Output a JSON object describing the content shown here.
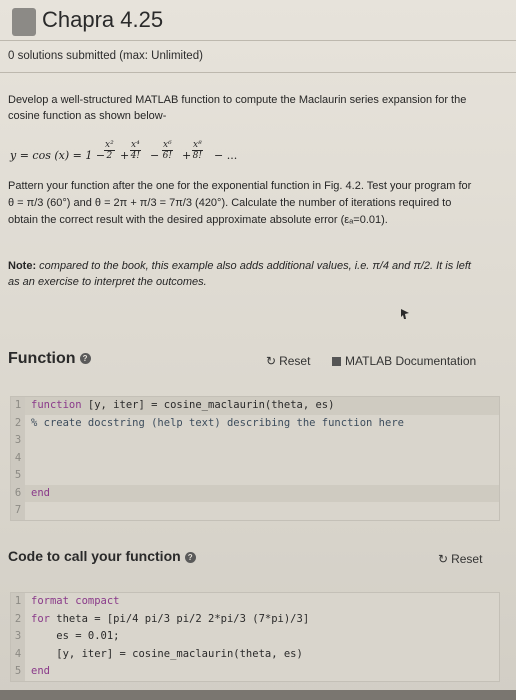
{
  "header": {
    "title": "Chapra 4.25",
    "submitted": "0 solutions submitted (max: Unlimited)"
  },
  "problem": {
    "intro": "Develop a well-structured MATLAB function to compute the Maclaurin series expansion for the cosine function as shown below-",
    "formula": {
      "lhs": "y = cos (x) = 1 −",
      "terms": [
        {
          "num": "x²",
          "den": "2",
          "op": "+"
        },
        {
          "num": "x⁴",
          "den": "4!",
          "op": "−"
        },
        {
          "num": "x⁶",
          "den": "6!",
          "op": "+"
        },
        {
          "num": "x⁸",
          "den": "8!",
          "op": "− ..."
        }
      ]
    },
    "pattern": "Pattern your function after the one for the exponential function in Fig. 4.2. Test your program for θ = π/3 (60°) and θ = 2π + π/3 = 7π/3 (420°). Calculate the number of iterations required to obtain the correct result with the desired approximate absolute error (εₐ=0.01).",
    "note_label": "Note:",
    "note_text": " compared to the book, this example also adds additional values, i.e. π/4 and π/2. It is left as an exercise to interpret the outcomes."
  },
  "function_section": {
    "title": "Function",
    "reset_label": "Reset",
    "doc_label": "MATLAB Documentation",
    "lines": [
      {
        "n": "1",
        "kw": "function",
        "text": " [y, iter] = cosine_maclaurin(theta, es)",
        "type": "kw"
      },
      {
        "n": "2",
        "text": "% create docstring (help text) describing the function here",
        "type": "comment"
      },
      {
        "n": "3",
        "text": "",
        "type": "plain"
      },
      {
        "n": "4",
        "text": "",
        "type": "plain"
      },
      {
        "n": "5",
        "text": "",
        "type": "plain"
      },
      {
        "n": "6",
        "kw": "end",
        "text": "",
        "type": "kw"
      },
      {
        "n": "7",
        "text": "",
        "type": "plain"
      }
    ]
  },
  "call_section": {
    "title": "Code to call your function",
    "reset_label": "Reset",
    "lines": [
      {
        "n": "1",
        "text": "format compact",
        "type": "kwline"
      },
      {
        "n": "2",
        "kw": "for",
        "text": " theta = [pi/4 pi/3 pi/2 2*pi/3 (7*pi)/3]",
        "type": "kw"
      },
      {
        "n": "3",
        "text": "    es = 0.01;",
        "type": "plain"
      },
      {
        "n": "4",
        "text": "    [y, iter] = cosine_maclaurin(theta, es)",
        "type": "plain"
      },
      {
        "n": "5",
        "kw": "end",
        "text": "",
        "type": "kw"
      }
    ]
  },
  "icons": {
    "reset": "refresh-icon",
    "help": "question-icon",
    "doc": "matlab-doc-icon"
  }
}
